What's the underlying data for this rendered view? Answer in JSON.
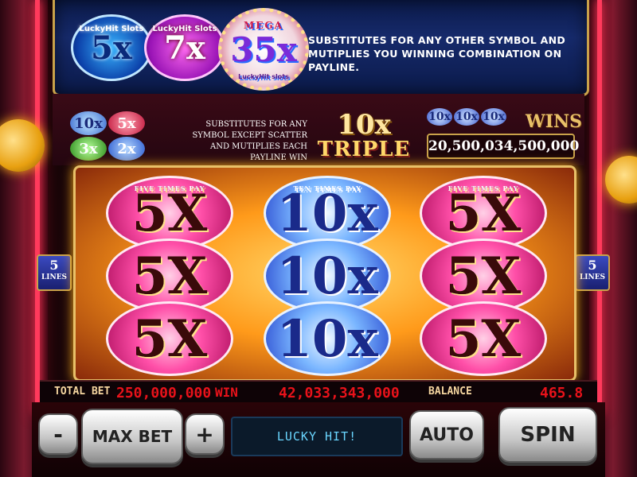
{
  "top_banner": {
    "badges": [
      {
        "label": "5x",
        "brand": "LuckyHit Slots"
      },
      {
        "label": "7x",
        "brand": "LuckyHit Slots"
      },
      {
        "label": "35x",
        "top": "MEGA",
        "brand": "LuckyHit slots"
      }
    ],
    "description": "SUBSTITUTES FOR ANY OTHER SYMBOL AND MUTIPLIES YOU WINNING COMBINATION ON PAYLINE."
  },
  "info": {
    "mini_badges": [
      "10x",
      "5x",
      "3x",
      "2x"
    ],
    "description": "SUBSTITUTES FOR ANY SYMBOL EXCEPT SCATTER AND MUTIPLIES EACH PAYLINE WIN",
    "logo_top": "10x",
    "logo_bottom": "TRIPLE",
    "wins_mini": [
      "10x",
      "10x",
      "10x"
    ],
    "wins_title": "WINS",
    "wins_value": "20,500,034,500,000"
  },
  "reels": [
    {
      "symbols": [
        "5X",
        "5X",
        "5X"
      ],
      "pay_text": "FIVE TIMES PAY"
    },
    {
      "symbols": [
        "10x",
        "10x",
        "10x"
      ],
      "pay_text": "TEN TIMES PAY"
    },
    {
      "symbols": [
        "5X",
        "5X",
        "5X"
      ],
      "pay_text": "FIVE TIMES PAY"
    }
  ],
  "lines": {
    "left_count": "5",
    "left_label": "LINES",
    "right_count": "5",
    "right_label": "LINES"
  },
  "status": {
    "total_bet_label": "TOTAL BET",
    "total_bet_value": "250,000,000",
    "win_label": "WIN",
    "win_value": "42,033,343,000",
    "balance_label": "BALANCE",
    "balance_value": "465.8"
  },
  "controls": {
    "minus": "-",
    "max_bet": "MAX BET",
    "plus": "+",
    "message": "LUCKY HIT!",
    "auto": "AUTO",
    "spin": "SPIN"
  }
}
